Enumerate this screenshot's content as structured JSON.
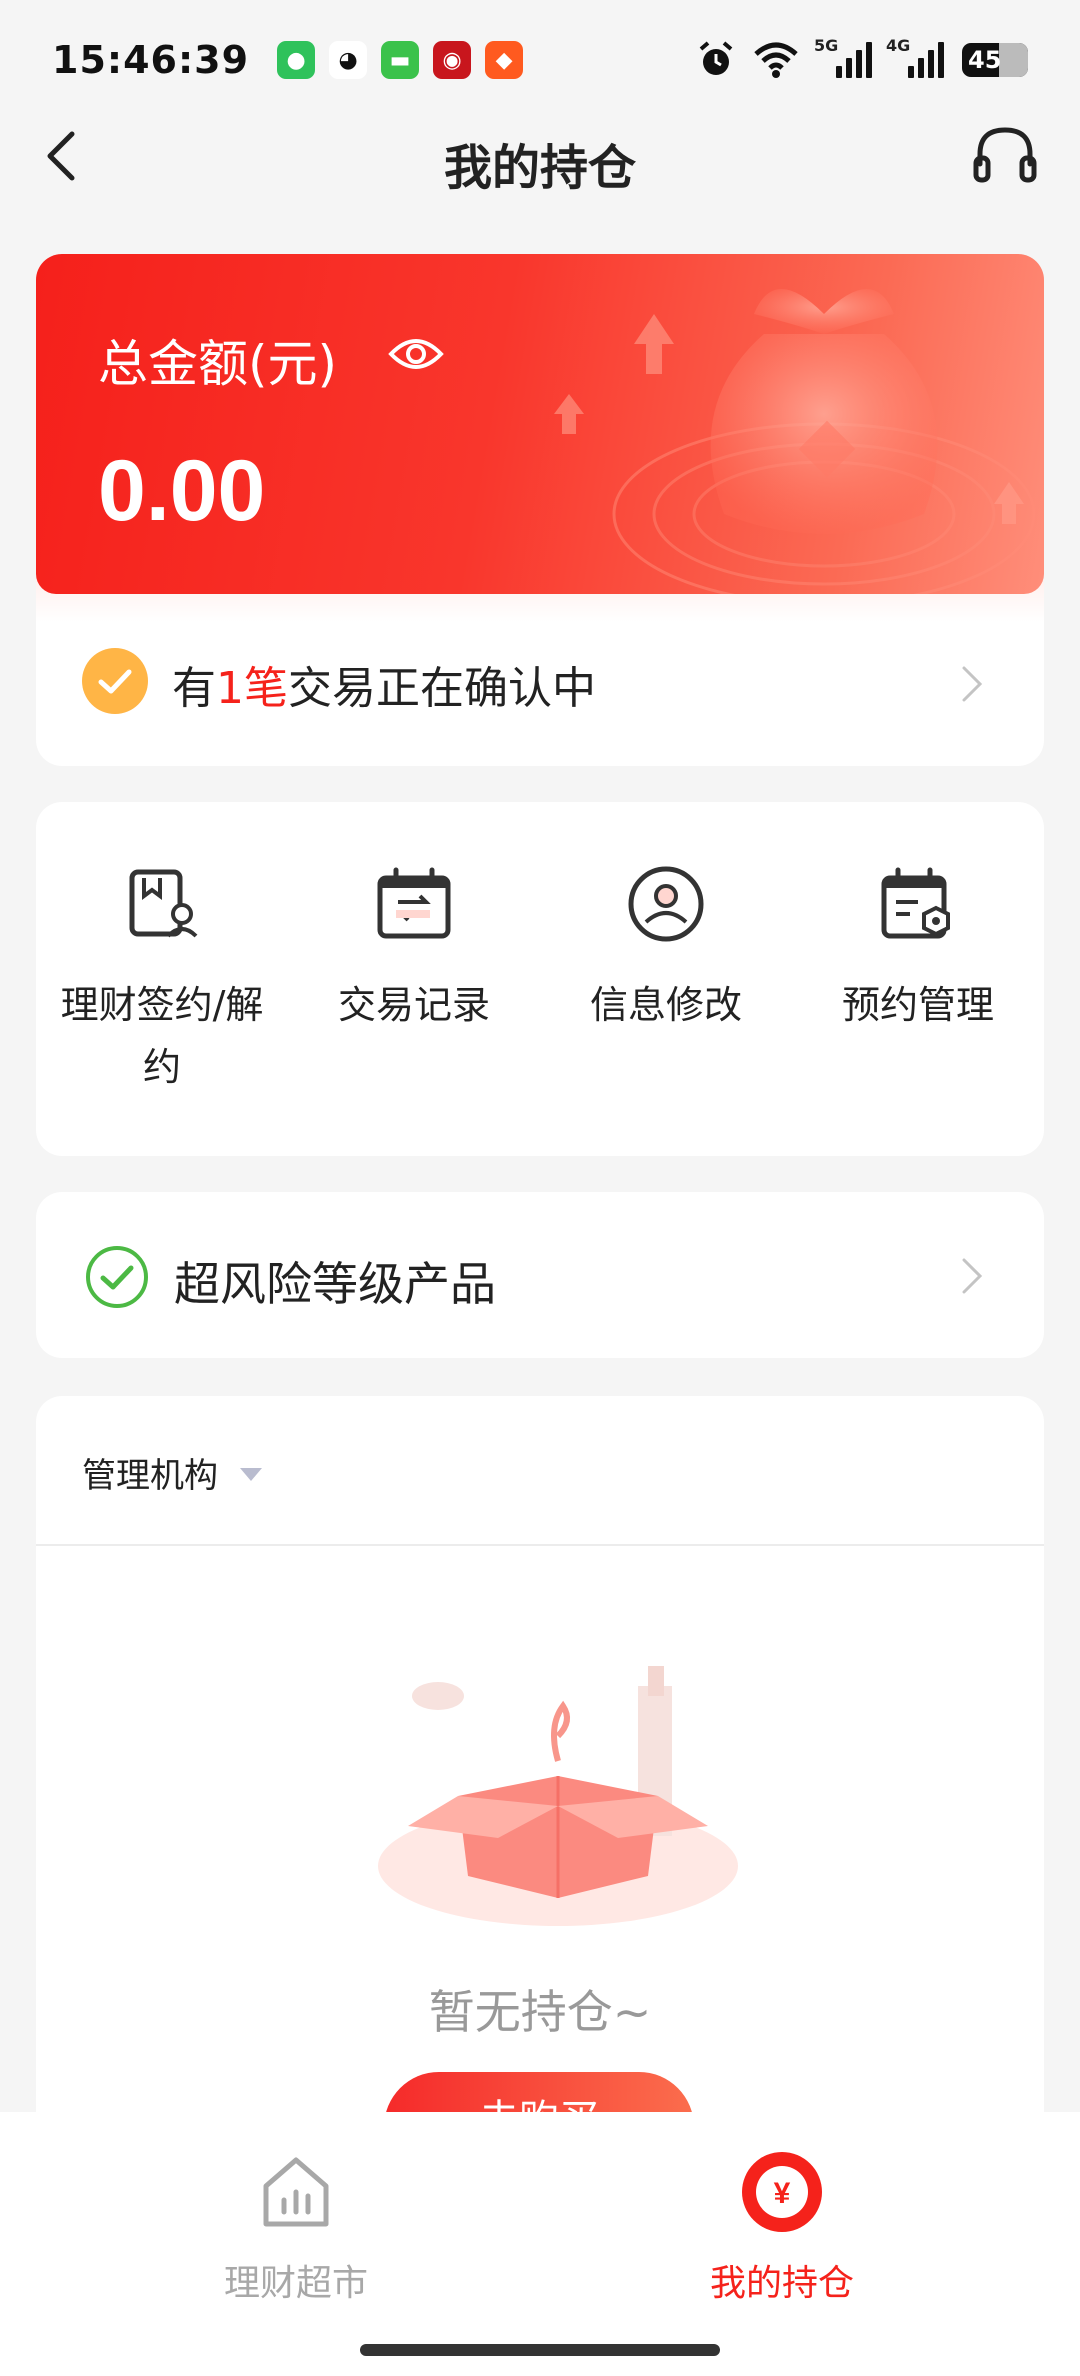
{
  "status_bar": {
    "time": "15:46:39",
    "apps": [
      "wechat-icon",
      "qq-icon",
      "messages-icon",
      "bank-app-icon",
      "taobao-icon"
    ],
    "signal_5g": "5G",
    "signal_4g": "4G",
    "battery": "45"
  },
  "nav": {
    "title": "我的持仓"
  },
  "summary": {
    "label": "总金额(元)",
    "amount": "0.00"
  },
  "pending": {
    "prefix": "有",
    "count": "1笔",
    "suffix": "交易正在确认中"
  },
  "quick_actions": [
    {
      "label": "理财签约/解约",
      "icon": "contract-icon"
    },
    {
      "label": "交易记录",
      "icon": "transaction-record-icon"
    },
    {
      "label": "信息修改",
      "icon": "user-info-icon"
    },
    {
      "label": "预约管理",
      "icon": "appointment-icon"
    }
  ],
  "risk": {
    "label": "超风险等级产品"
  },
  "holdings": {
    "filter_label": "管理机构",
    "empty_text": "暂无持仓~",
    "buy_label": "去购买"
  },
  "tabs": [
    {
      "label": "理财超市",
      "icon": "market-chart-icon",
      "active": false
    },
    {
      "label": "我的持仓",
      "icon": "yuan-holdings-icon",
      "active": true
    }
  ],
  "colors": {
    "accent": "#f5221b",
    "pending_icon": "#ffb546",
    "check_green": "#4cb944",
    "inactive_tab": "#a8a8a8"
  }
}
